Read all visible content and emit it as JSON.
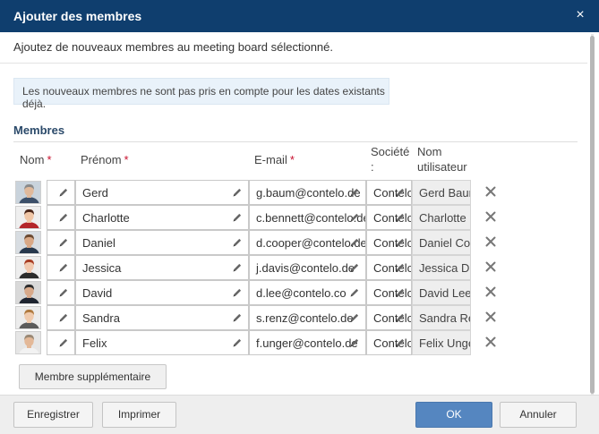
{
  "dialog": {
    "title": "Ajouter des membres",
    "close_glyph": "×",
    "subtitle": "Ajoutez de nouveaux membres au meeting board sélectionné.",
    "info": "Les nouveaux membres ne sont pas pris en compte pour les dates existants déjà."
  },
  "section": {
    "title": "Membres"
  },
  "headers": {
    "nom": "Nom",
    "prenom": "Prénom",
    "email": "E-mail",
    "societe_line1": "Société",
    "societe_line2": ":",
    "username_line1": "Nom",
    "username_line2": "utilisateur",
    "required_marker": "*"
  },
  "members": [
    {
      "first_name": "Gerd",
      "email": "g.baum@contelo.de",
      "company": "Contelo",
      "username": "Gerd Baum"
    },
    {
      "first_name": "Charlotte",
      "email": "c.bennett@contelo.de",
      "company": "Contelo",
      "username": "Charlotte Bennett"
    },
    {
      "first_name": "Daniel",
      "email": "d.cooper@contelo.de",
      "company": "Contelo",
      "username": "Daniel Cooper"
    },
    {
      "first_name": "Jessica",
      "email": "j.davis@contelo.de",
      "company": "Contelo",
      "username": "Jessica Davis"
    },
    {
      "first_name": "David",
      "email": "d.lee@contelo.co",
      "company": "Contelo",
      "username": "David Lee"
    },
    {
      "first_name": "Sandra",
      "email": "s.renz@contelo.de",
      "company": "Contelo",
      "username": "Sandra Renz"
    },
    {
      "first_name": "Felix",
      "email": "f.unger@contelo.de",
      "company": "Contelo",
      "username": "Felix Unger"
    }
  ],
  "buttons": {
    "add_member": "Membre supplémentaire",
    "save": "Enregistrer",
    "print": "Imprimer",
    "ok": "OK",
    "cancel": "Annuler"
  },
  "icons": {
    "edit": "pencil-icon",
    "delete": "close-icon",
    "avatar": "user-photo"
  },
  "colors": {
    "titlebar": "#0f3e6e",
    "info_bg": "#e9f2fa",
    "primary_button": "#5586c0",
    "required": "#c8102e",
    "section_title": "#2b4a6a"
  }
}
